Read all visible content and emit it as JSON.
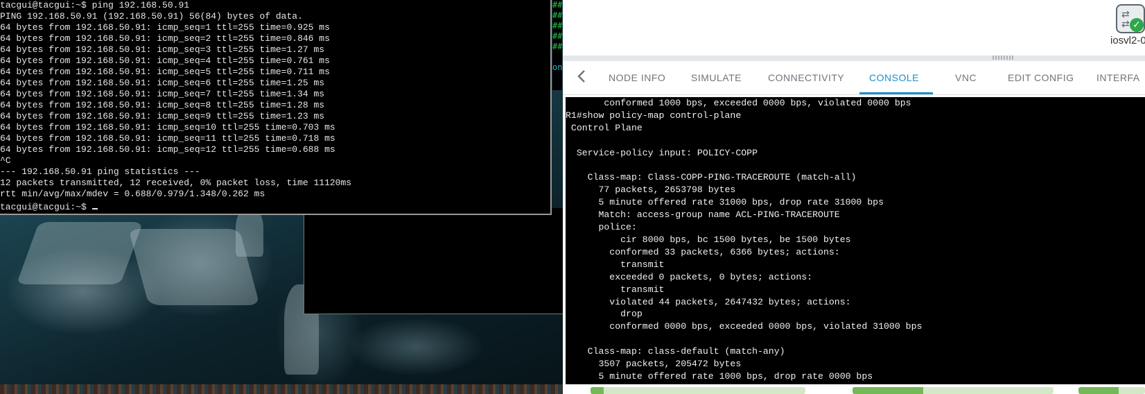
{
  "terminal": {
    "lines": [
      "tacgui@tacgui:~$ ping 192.168.50.91",
      "PING 192.168.50.91 (192.168.50.91) 56(84) bytes of data.",
      "64 bytes from 192.168.50.91: icmp_seq=1 ttl=255 time=0.925 ms",
      "64 bytes from 192.168.50.91: icmp_seq=2 ttl=255 time=0.846 ms",
      "64 bytes from 192.168.50.91: icmp_seq=3 ttl=255 time=1.27 ms",
      "64 bytes from 192.168.50.91: icmp_seq=4 ttl=255 time=0.761 ms",
      "64 bytes from 192.168.50.91: icmp_seq=5 ttl=255 time=0.711 ms",
      "64 bytes from 192.168.50.91: icmp_seq=6 ttl=255 time=1.25 ms",
      "64 bytes from 192.168.50.91: icmp_seq=7 ttl=255 time=1.34 ms",
      "64 bytes from 192.168.50.91: icmp_seq=8 ttl=255 time=1.28 ms",
      "64 bytes from 192.168.50.91: icmp_seq=9 ttl=255 time=1.23 ms",
      "64 bytes from 192.168.50.91: icmp_seq=10 ttl=255 time=0.703 ms",
      "64 bytes from 192.168.50.91: icmp_seq=11 ttl=255 time=0.718 ms",
      "64 bytes from 192.168.50.91: icmp_seq=12 ttl=255 time=0.688 ms",
      "^C",
      "--- 192.168.50.91 ping statistics ---",
      "12 packets transmitted, 12 received, 0% packet loss, time 11120ms",
      "rtt min/avg/max/mdev = 0.688/0.979/1.348/0.262 ms"
    ],
    "prompt": "tacgui@tacgui:~$ "
  },
  "edge_terminal": {
    "lines": [
      "##",
      "##",
      "##",
      "##",
      "##",
      "",
      "on"
    ]
  },
  "node": {
    "label": "iosvl2-0",
    "icon": "switch-icon",
    "status_icon": "check-icon"
  },
  "tabs": [
    {
      "label": "NODE INFO"
    },
    {
      "label": "SIMULATE"
    },
    {
      "label": "CONNECTIVITY"
    },
    {
      "label": "CONSOLE",
      "active": true
    },
    {
      "label": "VNC"
    },
    {
      "label": "EDIT CONFIG"
    },
    {
      "label": "INTERFA"
    }
  ],
  "console": {
    "lines": [
      "       conformed 1000 bps, exceeded 0000 bps, violated 0000 bps",
      "R1#show policy-map control-plane",
      " Control Plane",
      "",
      "  Service-policy input: POLICY-COPP",
      "",
      "    Class-map: Class-COPP-PING-TRACEROUTE (match-all)",
      "      77 packets, 2653798 bytes",
      "      5 minute offered rate 31000 bps, drop rate 31000 bps",
      "      Match: access-group name ACL-PING-TRACEROUTE",
      "      police:",
      "          cir 8000 bps, bc 1500 bytes, be 1500 bytes",
      "        conformed 33 packets, 6366 bytes; actions:",
      "          transmit",
      "        exceeded 0 packets, 0 bytes; actions:",
      "          transmit",
      "        violated 44 packets, 2647432 bytes; actions:",
      "          drop",
      "        conformed 0000 bps, exceeded 0000 bps, violated 31000 bps",
      "",
      "    Class-map: class-default (match-any)",
      "      3507 packets, 205472 bytes",
      "      5 minute offered rate 1000 bps, drop rate 0000 bps"
    ]
  },
  "colors": {
    "accent": "#1a90c9",
    "tab_inactive": "#6f757b",
    "status_ok": "#2ea84a",
    "progress": "#74b857"
  }
}
